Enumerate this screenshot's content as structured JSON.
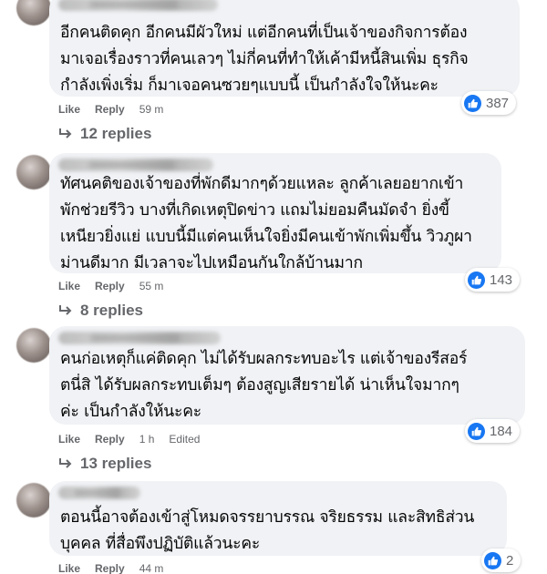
{
  "comments": [
    {
      "lines": [
        "อีกคนติดคุก อีกคนมีผัวใหม่ แต่อีกคนที่เป็นเจ้าของกิจการต้อง",
        "มาเจอเรื่องราวที่คนเลวๆ ไม่กี่คนที่ทำให้เค้ามีหนี้สินเพิ่ม ธุรกิจ",
        "กำลังเพิ่งเริ่ม ก็มาเจอคนซวยๆแบบนี้ เป็นกำลังใจให้นะคะ"
      ],
      "like_label": "Like",
      "reply_label": "Reply",
      "time": "59 m",
      "reaction_count": "387",
      "replies_label": "12 replies"
    },
    {
      "lines": [
        "ทัศนคติของเจ้าของที่พักดีมากๆด้วยแหละ ลูกค้าเลยอยากเข้า",
        "พักช่วยรีวิว บางที่เกิดเหตุปิดข่าว แถมไม่ยอมคืนมัดจำ ยิ่งขี้",
        "เหนียวยิ่งแย่ แบบนี้มีแต่คนเห็นใจยิ่งมีคนเข้าพักเพิ่มขึ้น วิวภูผา",
        "ม่านดีมาก มีเวลาจะไปเหมือนกันใกล้บ้านมาก"
      ],
      "like_label": "Like",
      "reply_label": "Reply",
      "time": "55 m",
      "reaction_count": "143",
      "replies_label": "8 replies"
    },
    {
      "lines": [
        "คนก่อเหตุก็แค่ติดคุก ไม่ได้รับผลกระทบอะไร แต่เจ้าของรีสอร์",
        "ตนี่สิ ได้รับผลกระทบเต็มๆ ต้องสูญเสียรายได้ น่าเห็นใจมากๆ",
        "ค่ะ เป็นกำลังให้นะคะ"
      ],
      "like_label": "Like",
      "reply_label": "Reply",
      "time": "1 h",
      "edited_label": "Edited",
      "reaction_count": "184",
      "replies_label": "13 replies"
    },
    {
      "lines": [
        "ตอนนี้อาจต้องเข้าสู่โหมดจรรยาบรรณ จริยธรรม และสิทธิส่วน",
        "บุคคล ที่สื่อพึงปฏิบัติแล้วนะคะ"
      ],
      "like_label": "Like",
      "reply_label": "Reply",
      "time": "44 m",
      "reaction_count": "2"
    }
  ],
  "colors": {
    "bubble_bg": "#f0f2f5",
    "meta_text": "#65676b",
    "like_blue": "#1877f2"
  },
  "icons": {
    "like": "thumbs-up-icon",
    "reply_arrow": "reply-arrow-icon"
  }
}
